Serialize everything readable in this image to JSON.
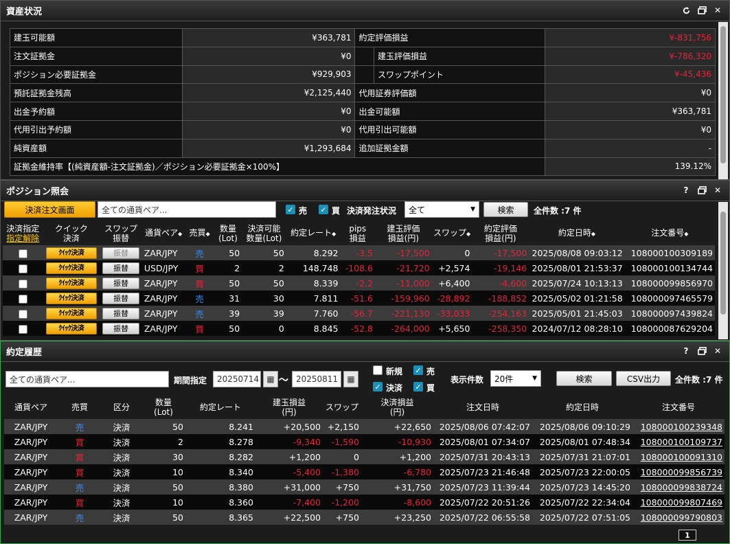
{
  "summary_panel": {
    "title": "資産状況",
    "rows": [
      {
        "l1": "建玉可能額",
        "v1": "¥363,781",
        "l2": "約定評価損益",
        "v2": "¥-831,756",
        "v2red": true,
        "indent": false
      },
      {
        "l1": "注文証拠金",
        "v1": "¥0",
        "l2": "建玉評価損益",
        "v2": "¥-786,320",
        "v2red": true,
        "indent": true
      },
      {
        "l1": "ポジション必要証拠金",
        "v1": "¥929,903",
        "l2": "スワップポイント",
        "v2": "¥-45,436",
        "v2red": true,
        "indent": true
      },
      {
        "l1": "預託証拠金残高",
        "v1": "¥2,125,440",
        "l2": "代用証券評価額",
        "v2": "¥0",
        "v2red": false,
        "indent": false
      },
      {
        "l1": "出金予約額",
        "v1": "¥0",
        "l2": "出金可能額",
        "v2": "¥363,781",
        "v2red": false,
        "indent": false
      },
      {
        "l1": "代用引出予約額",
        "v1": "¥0",
        "l2": "代用引出可能額",
        "v2": "¥0",
        "v2red": false,
        "indent": false
      },
      {
        "l1": "純資産額",
        "v1": "¥1,293,684",
        "l2": "追加証拠金額",
        "v2": "-",
        "v2red": false,
        "indent": false
      }
    ],
    "ratio_label": "証拠金維持率【(純資産額-注文証拠金)／ポジション必要証拠金×100%】",
    "ratio_value": "139.12%"
  },
  "position_panel": {
    "title": "ポジション照会",
    "settle_button": "決済注文画面",
    "pair_input": "全ての通貨ペア...",
    "sell_label": "売",
    "buy_label": "買",
    "status_label": "決済発注状況",
    "status_select": "全て",
    "search_button": "検索",
    "total": "全件数 :7 件",
    "headers": {
      "settle_designate": "決済指定",
      "designate_cancel": "指定解除",
      "quick1": "クイック",
      "quick2": "決済",
      "swap1": "スワップ",
      "swap2": "振替",
      "pair": "通貨ペア",
      "side": "売買",
      "qty1": "数量",
      "qty2": "(Lot)",
      "avail1": "決済可能",
      "avail2": "数量(Lot)",
      "rate": "約定レート",
      "pips1": "pips",
      "pips2": "損益",
      "eval1": "建玉評価",
      "eval2": "損益(円)",
      "swap": "スワップ",
      "teval1": "約定評価",
      "teval2": "損益(円)",
      "date": "約定日時",
      "order": "注文番号"
    },
    "quick_label": "ｸｲｯｸ決済",
    "transfer_label": "振替",
    "rows": [
      {
        "pair": "ZAR/JPY",
        "side": "売",
        "qty": "50",
        "avail": "50",
        "rate": "8.292",
        "pips": "-3.5",
        "eval": "-17,500",
        "swap": "0",
        "teval": "-17,500",
        "date": "2025/08/08 09:03:12",
        "order": "108000100309189"
      },
      {
        "pair": "USD/JPY",
        "side": "買",
        "qty": "2",
        "avail": "2",
        "rate": "148.748",
        "pips": "-108.6",
        "eval": "-21,720",
        "swap": "+2,574",
        "teval": "-19,146",
        "date": "2025/08/01 21:53:37",
        "order": "108000100134744"
      },
      {
        "pair": "ZAR/JPY",
        "side": "買",
        "qty": "50",
        "avail": "50",
        "rate": "8.339",
        "pips": "-2.2",
        "eval": "-11,000",
        "swap": "+6,400",
        "teval": "-4,600",
        "date": "2025/07/24 10:13:13",
        "order": "108000099856970"
      },
      {
        "pair": "ZAR/JPY",
        "side": "売",
        "qty": "31",
        "avail": "30",
        "rate": "7.811",
        "pips": "-51.6",
        "eval": "-159,960",
        "swap": "-28,892",
        "teval": "-188,852",
        "date": "2025/05/02 01:21:58",
        "order": "108000097465579"
      },
      {
        "pair": "ZAR/JPY",
        "side": "売",
        "qty": "39",
        "avail": "39",
        "rate": "7.760",
        "pips": "-56.7",
        "eval": "-221,130",
        "swap": "-33,033",
        "teval": "-254,163",
        "date": "2025/05/01 21:45:03",
        "order": "108000097439824"
      },
      {
        "pair": "ZAR/JPY",
        "side": "買",
        "qty": "50",
        "avail": "0",
        "rate": "8.845",
        "pips": "-52.8",
        "eval": "-264,000",
        "swap": "+5,650",
        "teval": "-258,350",
        "date": "2024/07/12 08:28:10",
        "order": "108000087629204"
      }
    ]
  },
  "history_panel": {
    "title": "約定履歴",
    "pair_input": "全ての通貨ペア...",
    "period_label": "期間指定",
    "date_from": "20250714",
    "tilde": "〜",
    "date_to": "20250811",
    "new_label": "新規",
    "settle_label": "決済",
    "sell_label": "売",
    "buy_label": "買",
    "count_label": "表示件数",
    "count_select": "20件",
    "search_button": "検索",
    "csv_button": "CSV出力",
    "total": "全件数 :7 件",
    "headers": {
      "pair": "通貨ペア",
      "side": "売買",
      "kind": "区分",
      "qty1": "数量",
      "qty2": "(Lot)",
      "rate": "約定レート",
      "pnl1": "建玉損益",
      "pnl2": "(円)",
      "swap": "スワップ",
      "spnl1": "決済損益",
      "spnl2": "(円)",
      "odate": "注文日時",
      "edate": "約定日時",
      "order": "注文番号"
    },
    "rows": [
      {
        "pair": "ZAR/JPY",
        "side": "売",
        "kind": "決済",
        "qty": "50",
        "rate": "8.241",
        "pnl": "+20,500",
        "swap": "+2,150",
        "spnl": "+22,650",
        "odate": "2025/08/06 07:42:07",
        "edate": "2025/08/06 09:10:29",
        "order": "108000100239348"
      },
      {
        "pair": "ZAR/JPY",
        "side": "買",
        "kind": "決済",
        "qty": "2",
        "rate": "8.278",
        "pnl": "-9,340",
        "swap": "-1,590",
        "spnl": "-10,930",
        "odate": "2025/08/01 07:34:07",
        "edate": "2025/08/01 07:48:34",
        "order": "108000100109737"
      },
      {
        "pair": "ZAR/JPY",
        "side": "買",
        "kind": "決済",
        "qty": "30",
        "rate": "8.282",
        "pnl": "+1,200",
        "swap": "0",
        "spnl": "+1,200",
        "odate": "2025/07/31 20:43:13",
        "edate": "2025/07/31 21:07:01",
        "order": "108000100091310"
      },
      {
        "pair": "ZAR/JPY",
        "side": "買",
        "kind": "決済",
        "qty": "10",
        "rate": "8.340",
        "pnl": "-5,400",
        "swap": "-1,380",
        "spnl": "-6,780",
        "odate": "2025/07/23 21:46:48",
        "edate": "2025/07/23 22:00:05",
        "order": "108000099856739"
      },
      {
        "pair": "ZAR/JPY",
        "side": "売",
        "kind": "決済",
        "qty": "50",
        "rate": "8.380",
        "pnl": "+31,000",
        "swap": "+750",
        "spnl": "+31,750",
        "odate": "2025/07/23 11:39:44",
        "edate": "2025/07/23 14:45:20",
        "order": "108000099838724"
      },
      {
        "pair": "ZAR/JPY",
        "side": "買",
        "kind": "決済",
        "qty": "10",
        "rate": "8.360",
        "pnl": "-7,400",
        "swap": "-1,200",
        "spnl": "-8,600",
        "odate": "2025/07/22 20:51:26",
        "edate": "2025/07/22 22:34:04",
        "order": "108000099807469"
      },
      {
        "pair": "ZAR/JPY",
        "side": "売",
        "kind": "決済",
        "qty": "50",
        "rate": "8.365",
        "pnl": "+22,500",
        "swap": "+750",
        "spnl": "+23,250",
        "odate": "2025/07/22 06:55:58",
        "edate": "2025/07/22 07:51:05",
        "order": "108000099790803"
      }
    ],
    "page": "1"
  },
  "colors": {
    "sell": "#3a8ae8",
    "buy": "#e8233a",
    "negative": "#e8233a",
    "accent": "#f0a000"
  },
  "icons": [
    "refresh-icon",
    "restore-icon",
    "close-icon",
    "help-icon",
    "calendar-icon",
    "checkbox-checked-icon",
    "sort-arrows-icon"
  ]
}
